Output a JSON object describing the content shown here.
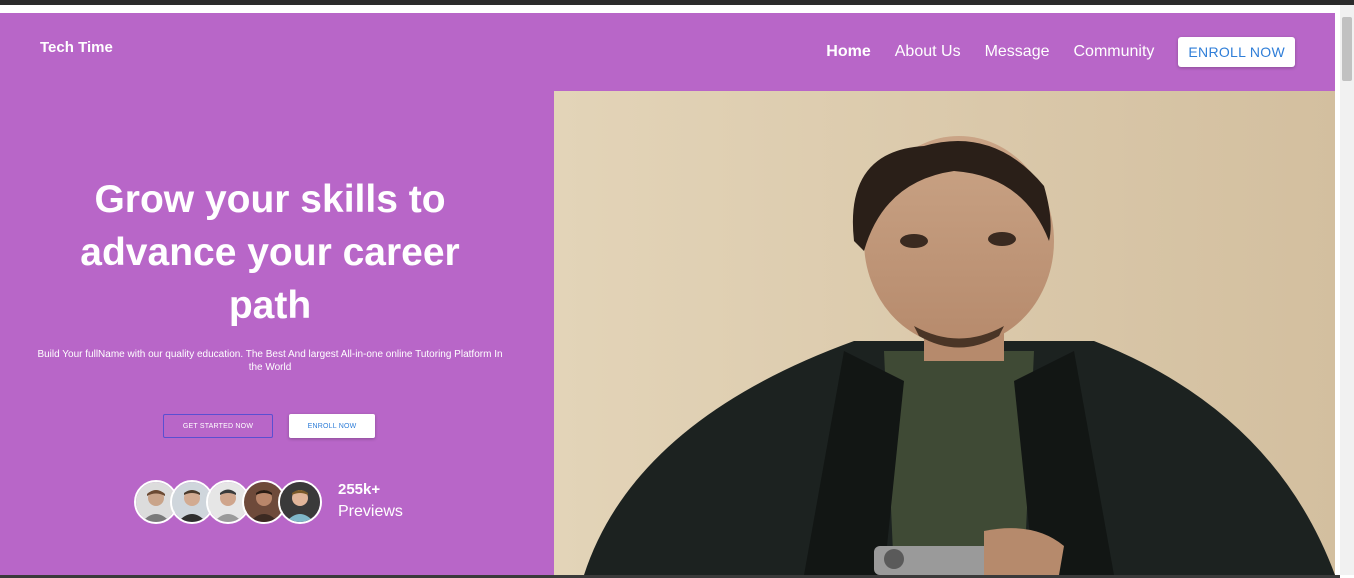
{
  "brand": "Tech Time",
  "nav": {
    "items": [
      {
        "label": "Home",
        "active": true
      },
      {
        "label": "About Us"
      },
      {
        "label": "Message"
      },
      {
        "label": "Community"
      }
    ],
    "enroll_label": "ENROLL NOW"
  },
  "hero": {
    "headline": "Grow your skills to advance your career path",
    "subtext": "Build Your fullName with our quality education. The Best And largest All-in-one online Tutoring Platform In the World",
    "primary_button": "GET STARTED NOW",
    "secondary_button": "ENROLL NOW",
    "stats_number": "255k+",
    "stats_label": "Previews"
  },
  "colors": {
    "hero_bg": "#b866c8",
    "accent_blue": "#2f7ed8",
    "outline_border": "#5a4fd1"
  },
  "icons": {
    "avatars": [
      "avatar-1",
      "avatar-2",
      "avatar-3",
      "avatar-4",
      "avatar-5"
    ]
  }
}
